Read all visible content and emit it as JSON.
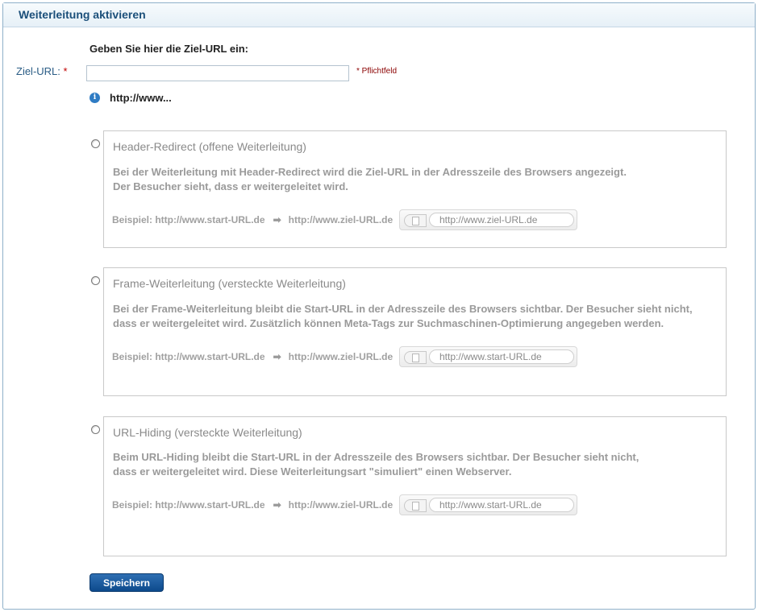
{
  "panel": {
    "title": "Weiterleitung aktivieren"
  },
  "form": {
    "prompt": "Geben Sie hier die Ziel-URL ein:",
    "ziel_label": "Ziel-URL:",
    "ziel_required_mark": "*",
    "ziel_value": "",
    "required_note": "* Pflichtfeld",
    "info_text": "http://www..."
  },
  "options": [
    {
      "title": "Header-Redirect (offene Weiterleitung)",
      "desc_line1": "Bei der Weiterleitung mit Header-Redirect wird die Ziel-URL in der Adresszeile des Browsers angezeigt.",
      "desc_line2": "Der Besucher sieht, dass er weitergeleitet wird.",
      "example_label": "Beispiel: http://www.start-URL.de",
      "example_target": "http://www.ziel-URL.de",
      "browser_url": "http://www.ziel-URL.de",
      "selected": false
    },
    {
      "title": "Frame-Weiterleitung (versteckte Weiterleitung)",
      "desc_line1": "Bei der Frame-Weiterleitung bleibt die Start-URL in der Adresszeile des Browsers sichtbar. Der Besucher sieht nicht,",
      "desc_line2": "dass er weitergeleitet wird. Zusätzlich können Meta-Tags zur Suchmaschinen-Optimierung angegeben werden.",
      "example_label": "Beispiel: http://www.start-URL.de",
      "example_target": "http://www.ziel-URL.de",
      "browser_url": "http://www.start-URL.de",
      "selected": false
    },
    {
      "title": "URL-Hiding (versteckte Weiterleitung)",
      "desc_line1": "Beim URL-Hiding bleibt die Start-URL in der Adresszeile des Browsers sichtbar. Der Besucher sieht nicht,",
      "desc_line2": "dass er weitergeleitet wird. Diese Weiterleitungsart \"simuliert\" einen Webserver.",
      "example_label": "Beispiel: http://www.start-URL.de",
      "example_target": "http://www.ziel-URL.de",
      "browser_url": "http://www.start-URL.de",
      "selected": false
    }
  ],
  "actions": {
    "save_label": "Speichern"
  },
  "icons": {
    "info": "info-icon",
    "arrow": "arrow-right-icon",
    "page": "page-icon"
  },
  "colors": {
    "header_text": "#1b4f7a",
    "button": "#0d4a8c",
    "required": "#8b0000",
    "info": "#2f7cc4"
  }
}
